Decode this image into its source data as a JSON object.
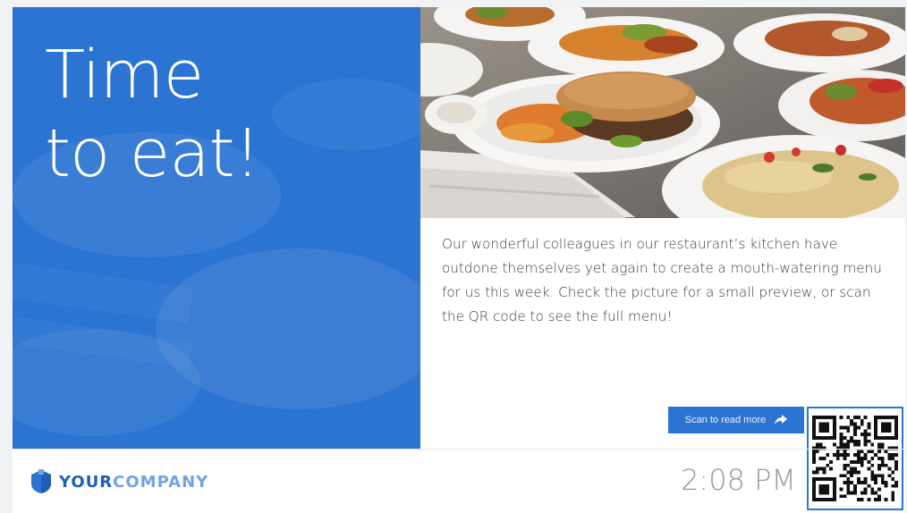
{
  "headline": {
    "line1": "Time",
    "line2": "to eat!"
  },
  "body": {
    "text": "Our wonderful colleagues in our restaurant’s kitchen have outdone themselves yet again to create a mouth-watering menu for us this week. Check the picture for a small preview, or scan the QR code to see the full menu!"
  },
  "cta": {
    "label": "Scan to read more",
    "icon": "share-arrow-icon"
  },
  "footer": {
    "logo": {
      "part1": "YOUR",
      "part2": "COMPANY",
      "icon": "shield-icon"
    },
    "time": "2:08 PM"
  },
  "colors": {
    "accent": "#2c74d2",
    "logo_dark": "#1e5fb8",
    "logo_light": "#6ea4e6",
    "time": "#9a9a9a"
  }
}
